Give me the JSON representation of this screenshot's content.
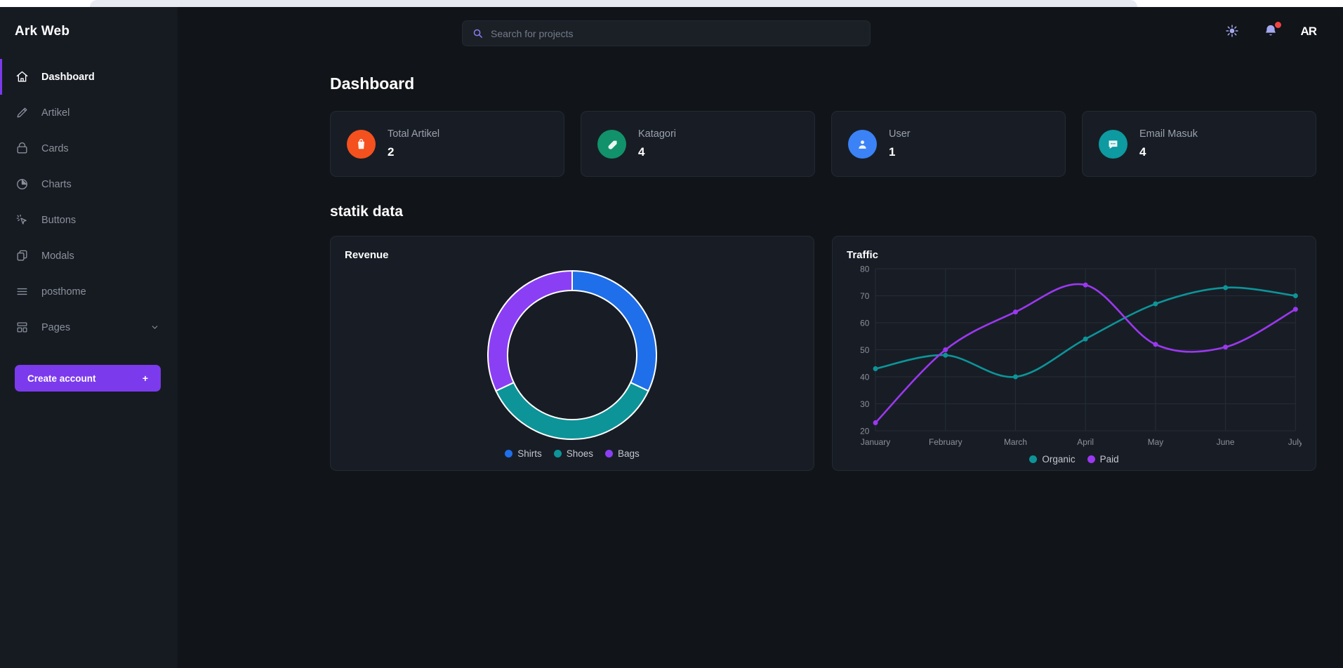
{
  "browser": {
    "tab_strip": ""
  },
  "sidebar": {
    "brand": "Ark Web",
    "items": [
      {
        "label": "Dashboard",
        "icon": "home-icon",
        "active": true
      },
      {
        "label": "Artikel",
        "icon": "pencil-icon",
        "active": false
      },
      {
        "label": "Cards",
        "icon": "card-icon",
        "active": false
      },
      {
        "label": "Charts",
        "icon": "pie-chart-icon",
        "active": false
      },
      {
        "label": "Buttons",
        "icon": "cursor-click-icon",
        "active": false
      },
      {
        "label": "Modals",
        "icon": "copy-icon",
        "active": false
      },
      {
        "label": "posthome",
        "icon": "list-icon",
        "active": false
      },
      {
        "label": "Pages",
        "icon": "layout-icon",
        "active": false,
        "expandable": true
      }
    ],
    "cta": {
      "label": "Create account",
      "plus": "+"
    },
    "accent_color": "#7c3aed"
  },
  "topbar": {
    "search": {
      "placeholder": "Search for projects",
      "value": ""
    },
    "theme_toggle": "sun-icon",
    "notifications": {
      "icon": "bell-icon",
      "has_unread": true,
      "dot_color": "#ef4444"
    },
    "avatar": "AR"
  },
  "main": {
    "page_title": "Dashboard",
    "section_title": "statik data",
    "stats": [
      {
        "label": "Total Artikel",
        "value": "2",
        "icon": "shopping-bag-icon",
        "color": "#f4511e"
      },
      {
        "label": "Katagori",
        "value": "4",
        "icon": "tag-icon",
        "color": "#12926a"
      },
      {
        "label": "User",
        "value": "1",
        "icon": "user-icon",
        "color": "#3b82f6"
      },
      {
        "label": "Email Masuk",
        "value": "4",
        "icon": "chat-icon",
        "color": "#0d9aa0"
      }
    ]
  },
  "chart_data": [
    {
      "type": "pie",
      "title": "Revenue",
      "variant": "donut",
      "labels": [
        "Shirts",
        "Shoes",
        "Bags"
      ],
      "values": [
        32,
        36,
        32
      ],
      "colors": [
        "#1f6feb",
        "#0d9499",
        "#8b3ff5"
      ],
      "legend_position": "bottom",
      "start_angle": 0
    },
    {
      "type": "line",
      "title": "Traffic",
      "categories": [
        "January",
        "February",
        "March",
        "April",
        "May",
        "June",
        "July"
      ],
      "series": [
        {
          "name": "Organic",
          "color": "#0d9499",
          "values": [
            43,
            48,
            40,
            54,
            67,
            73,
            70
          ]
        },
        {
          "name": "Paid",
          "color": "#9b38f0",
          "values": [
            23,
            50,
            64,
            74,
            52,
            51,
            65
          ]
        }
      ],
      "ylim": [
        20,
        80
      ],
      "yticks": [
        20,
        30,
        40,
        50,
        60,
        70,
        80
      ],
      "xlabel": "",
      "ylabel": "",
      "grid": true,
      "legend_position": "bottom",
      "smooth": true
    }
  ]
}
